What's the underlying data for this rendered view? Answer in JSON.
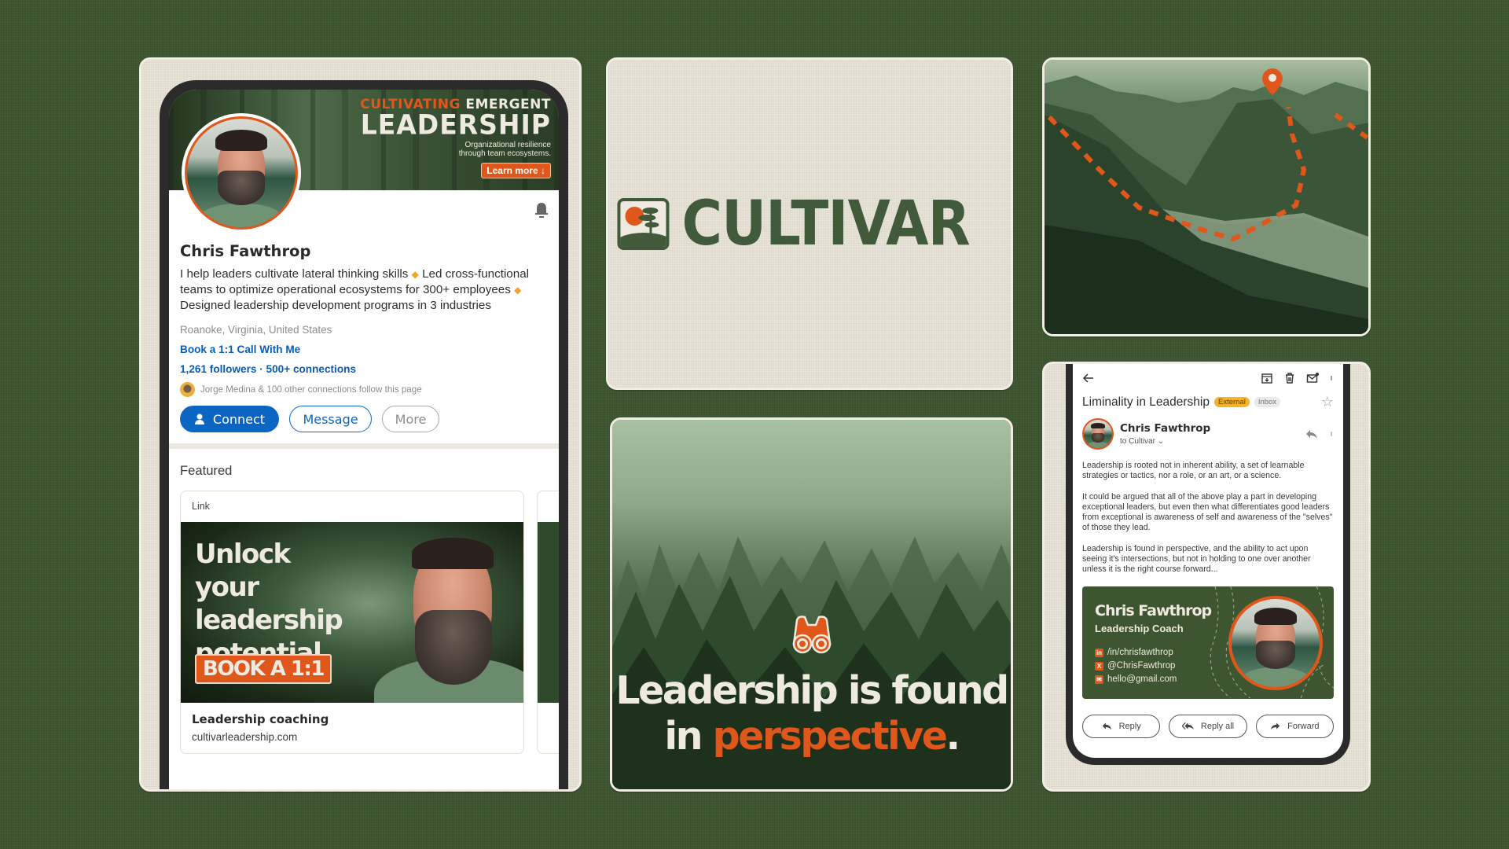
{
  "profile": {
    "banner": {
      "line1_highlight": "CULTIVATING",
      "line1_rest": "EMERGENT",
      "line2": "LEADERSHIP",
      "subtitle_1": "Organizational resilience",
      "subtitle_2": "through team ecosystems.",
      "cta": "Learn more ↓"
    },
    "name": "Chris Fawthrop",
    "headline_parts": [
      "I help leaders cultivate lateral thinking skills",
      "Led cross-functional teams to optimize operational ecosystems for 300+ employees",
      "Designed leadership development programs in 3 industries"
    ],
    "location": "Roanoke, Virginia, United States",
    "booking_link": "Book a 1:1 Call With Me",
    "stats": "1,261 followers · 500+ connections",
    "mutual": "Jorge Medina & 100 other connections follow this page",
    "buttons": {
      "connect": "Connect",
      "message": "Message",
      "more": "More"
    },
    "featured": {
      "title": "Featured",
      "cards": [
        {
          "type": "Link",
          "image_text": "Unlock your leadership potential",
          "image_button": "BOOK A 1:1",
          "title": "Leadership coaching",
          "url": "cultivarleadership.com"
        }
      ]
    }
  },
  "logo": {
    "wordmark": "CULTIVAR"
  },
  "quote": {
    "text_1": "Leadership is found",
    "text_2_pre": "in ",
    "text_2_highlight": "perspective",
    "text_2_post": "."
  },
  "email": {
    "subject": "Liminality in Leadership",
    "tags": [
      "External",
      "Inbox"
    ],
    "sender_name": "Chris Fawthrop",
    "sender_to": "to Cultivar",
    "body": [
      "Leadership is rooted not in inherent ability, a set of learnable strategies or tactics, nor a role, or an art, or a science.",
      "It could be argued that all of the above play a part in developing exceptional leaders, but even then what differentiates good leaders from exceptional is awareness of self and awareness of the \"selves\" of those they lead.",
      "Leadership is found in perspective, and the ability to act upon seeing it's intersections, but not in holding to one over another unless it is the right course forward..."
    ],
    "signature": {
      "name": "Chris Fawthrop",
      "role": "Leadership Coach",
      "links": [
        {
          "icon": "linkedin-icon",
          "glyph": "in",
          "text": "/in/chrisfawthrop"
        },
        {
          "icon": "x-icon",
          "glyph": "X",
          "text": "@ChrisFawthrop"
        },
        {
          "icon": "mail-icon",
          "glyph": "✉",
          "text": "hello@gmail.com"
        }
      ]
    },
    "actions": {
      "reply": "Reply",
      "reply_all": "Reply all",
      "forward": "Forward"
    }
  },
  "colors": {
    "background_green": "#3d5530",
    "linen": "#e8e3d7",
    "accent_orange": "#e0571c",
    "brand_green": "#405a3a",
    "linkedin_blue": "#0a66c2"
  }
}
